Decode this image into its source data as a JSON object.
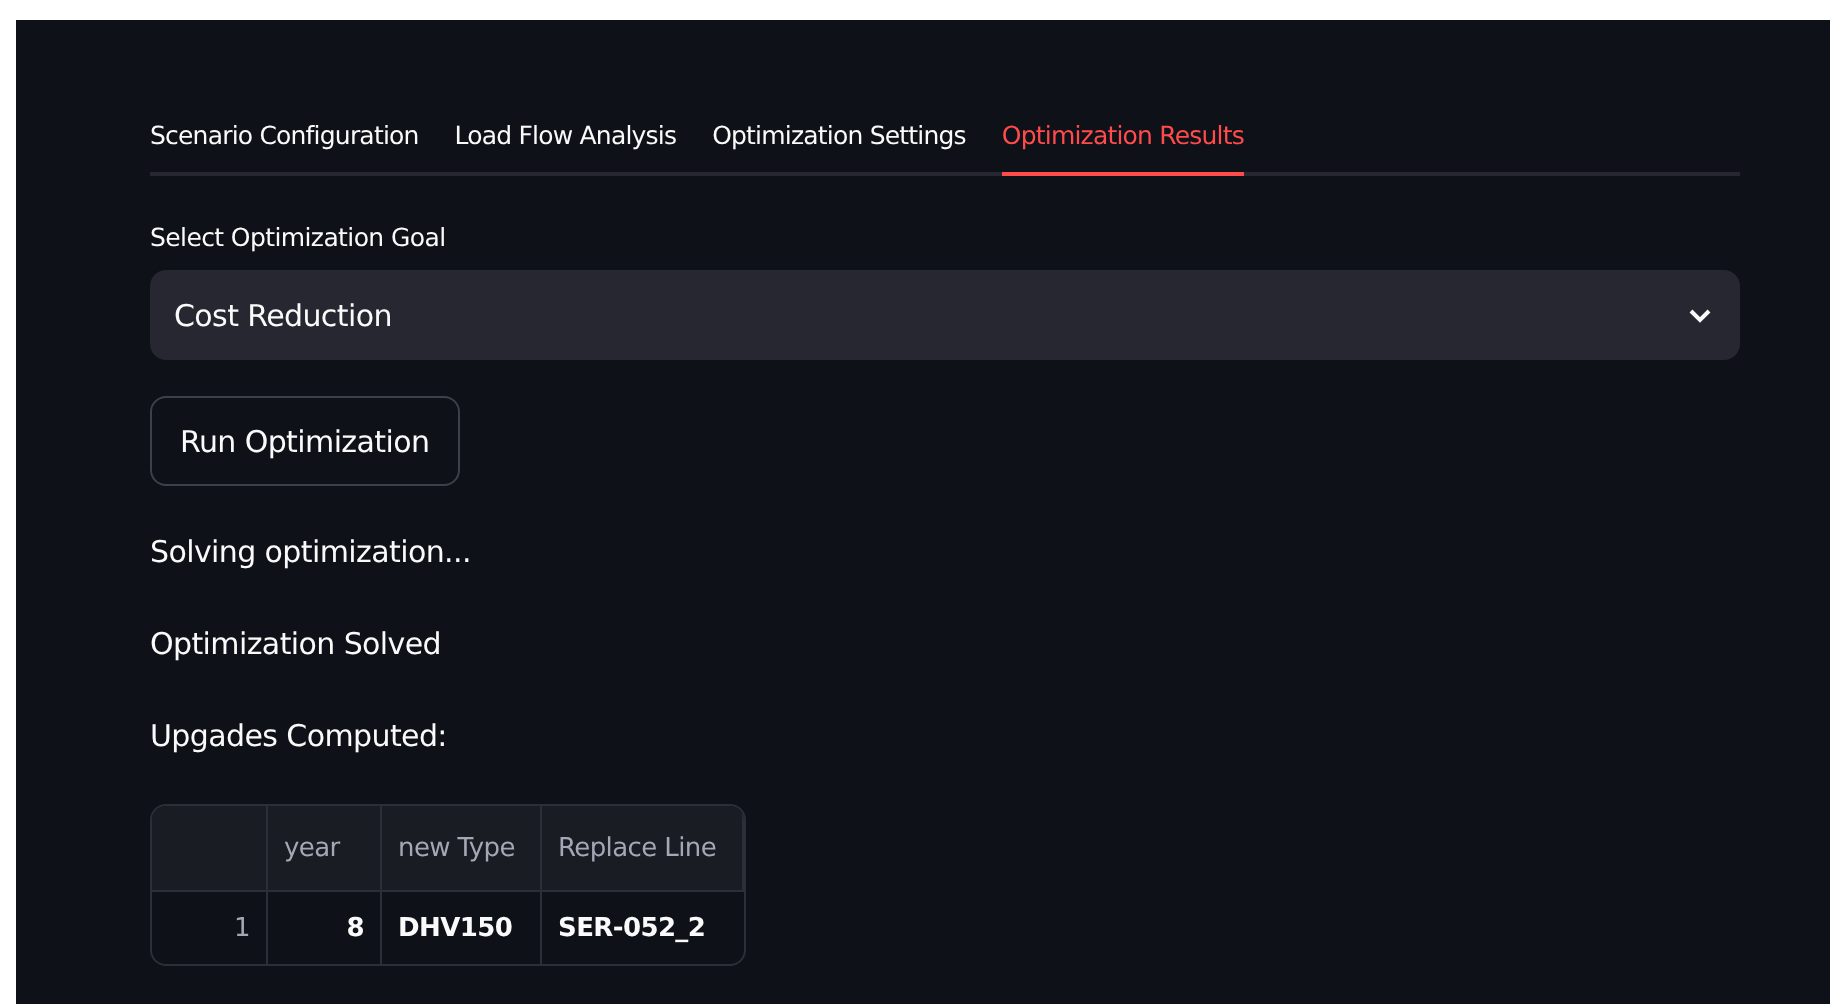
{
  "tabs": [
    {
      "label": "Scenario Configuration",
      "selected": false
    },
    {
      "label": "Load Flow Analysis",
      "selected": false
    },
    {
      "label": "Optimization Settings",
      "selected": false
    },
    {
      "label": "Optimization Results",
      "selected": true
    }
  ],
  "goal_select": {
    "label": "Select Optimization Goal",
    "value": "Cost Reduction"
  },
  "run_button": "Run Optimization",
  "messages": [
    "Solving optimization...",
    "Optimization Solved",
    "Upgades Computed:"
  ],
  "table": {
    "columns": [
      "year",
      "new Type",
      "Replace Line"
    ],
    "rows": [
      {
        "index": "1",
        "cells": [
          "8",
          "DHV150",
          "SER-052_2"
        ]
      }
    ]
  }
}
